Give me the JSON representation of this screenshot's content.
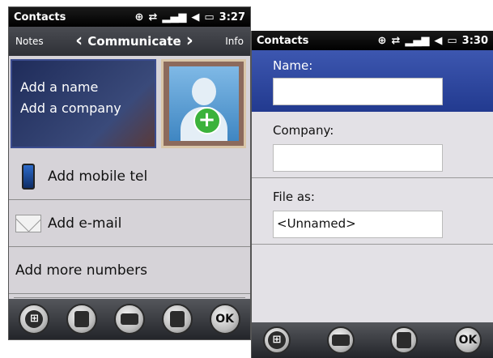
{
  "left_screen": {
    "status": {
      "title": "Contacts",
      "time": "3:27"
    },
    "tabs": {
      "left": "Notes",
      "center": "Communicate",
      "right": "Info"
    },
    "name_card": {
      "name": "Add a name",
      "company": "Add a company"
    },
    "rows": [
      {
        "label": "Add mobile tel",
        "icon": "mobile-phone-icon"
      },
      {
        "label": "Add e-mail",
        "icon": "envelope-icon"
      },
      {
        "label": "Add more numbers"
      }
    ],
    "softkeys": {
      "ok": "OK"
    }
  },
  "right_screen": {
    "status": {
      "title": "Contacts",
      "time": "3:30"
    },
    "fields": [
      {
        "label": "Name:",
        "value": ""
      },
      {
        "label": "Company:",
        "value": ""
      },
      {
        "label": "File as:",
        "value": "<Unnamed>"
      }
    ],
    "softkeys": {
      "ok": "OK"
    }
  },
  "icons": {
    "start": "windows-start-icon",
    "edit": "edit-icon",
    "keyboard": "keyboard-icon",
    "menu": "menu-icon"
  },
  "colors": {
    "selection": "#2f4aa0",
    "status_bar": "#000000"
  }
}
